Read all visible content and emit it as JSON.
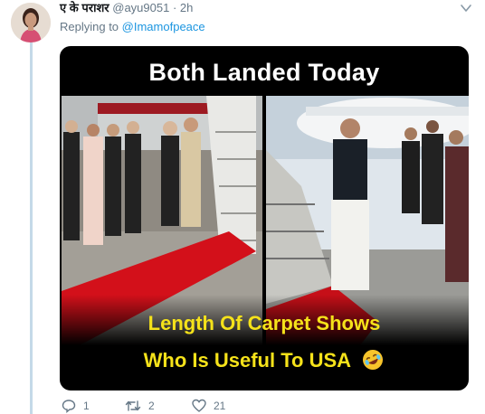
{
  "tweet": {
    "display_name": "ए के पराशर",
    "handle": "@ayu9051",
    "separator": "·",
    "time": "2h",
    "replying_prefix": "Replying to",
    "replying_to": "@Imamofpeace"
  },
  "media": {
    "title": "Both Landed Today",
    "caption_line1": "Length Of Carpet Shows",
    "caption_line2": "Who Is Useful To USA",
    "emoji": "rolling-on-floor-laughing-emoji"
  },
  "actions": {
    "reply_count": "1",
    "retweet_count": "2",
    "like_count": "21"
  },
  "colors": {
    "accent": "#1b95e0",
    "muted": "#657786",
    "caption_yellow": "#f5e21a",
    "carpet_red": "#d3101a",
    "thread_line": "#c4d9e8"
  }
}
